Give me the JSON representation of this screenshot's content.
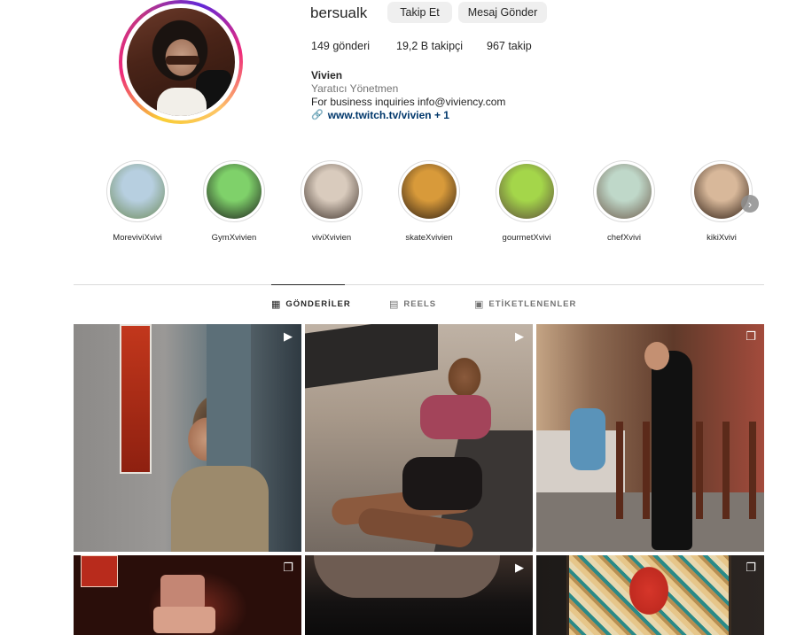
{
  "profile": {
    "username": "bersualk",
    "follow_label": "Takip Et",
    "message_label": "Mesaj Gönder",
    "stats": {
      "posts": "149 gönderi",
      "followers": "19,2 B takipçi",
      "following": "967 takip"
    },
    "bio": {
      "name": "Vivien",
      "category": "Yaratıcı Yönetmen",
      "text": "For business inquiries info@viviency.com",
      "link": "www.twitch.tv/vivien + 1"
    }
  },
  "highlights": [
    {
      "label": "MoreviviXvivi",
      "colors": [
        "#b7cfe0",
        "#6c8a58"
      ]
    },
    {
      "label": "GymXvivien",
      "colors": [
        "#7fd16a",
        "#1a1a1a"
      ]
    },
    {
      "label": "viviXvivien",
      "colors": [
        "#d9cbbd",
        "#3b2f28"
      ]
    },
    {
      "label": "skateXvivien",
      "colors": [
        "#d89a3a",
        "#2a1c12"
      ]
    },
    {
      "label": "gourmetXvivi",
      "colors": [
        "#a4d64a",
        "#5c4a3a"
      ]
    },
    {
      "label": "chefXvivi",
      "colors": [
        "#bfd8c9",
        "#6d5a4a"
      ]
    },
    {
      "label": "kikiXvivi",
      "colors": [
        "#d8b89a",
        "#2a1a10"
      ]
    }
  ],
  "tabs": [
    {
      "label": "GÖNDERİLER",
      "icon": "grid-icon",
      "active": true
    },
    {
      "label": "REELS",
      "icon": "reels-icon",
      "active": false
    },
    {
      "label": "ETİKETLENENLER",
      "icon": "tagged-icon",
      "active": false
    }
  ],
  "posts": [
    {
      "badge": "reels-icon"
    },
    {
      "badge": "reels-icon"
    },
    {
      "badge": "carousel-icon"
    },
    {
      "badge": "carousel-icon"
    },
    {
      "badge": "reels-icon"
    },
    {
      "badge": "carousel-icon"
    }
  ],
  "colors": {
    "text": "#262626",
    "muted": "#737373",
    "link": "#00376b",
    "button_bg": "#efefef",
    "divider": "#dbdbdb"
  }
}
